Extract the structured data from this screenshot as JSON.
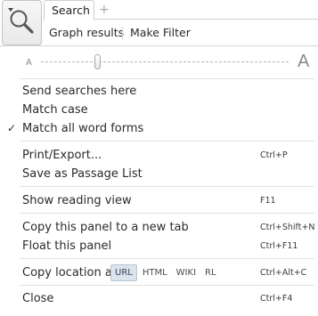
{
  "header": {
    "tabs": [
      {
        "label": "Search"
      }
    ],
    "add_tab_label": "+",
    "toolbar": {
      "graph_results": "Graph results",
      "make_filter": "Make Filter"
    }
  },
  "zoom": {
    "small_label": "A",
    "large_label": "A",
    "level": 0.23
  },
  "menu": {
    "send_searches_here": "Send searches here",
    "match_case": "Match case",
    "match_all_word_forms": {
      "label": "Match all word forms",
      "checked": true,
      "check_glyph": "✓"
    },
    "print_export": {
      "label": "Print/Export...",
      "shortcut": "Ctrl+P"
    },
    "save_passage_list": "Save as Passage List",
    "show_reading_view": {
      "label": "Show reading view",
      "shortcut": "F11"
    },
    "copy_panel_new_tab": {
      "label": "Copy this panel to a new tab",
      "shortcut": "Ctrl+Shift+N"
    },
    "float_panel": {
      "label": "Float this panel",
      "shortcut": "Ctrl+F11"
    },
    "copy_location": {
      "label": "Copy location as:",
      "options": [
        "URL",
        "HTML",
        "WIKI",
        "RL"
      ],
      "selected": "URL",
      "shortcut": "Ctrl+Alt+C"
    },
    "close": {
      "label": "Close",
      "shortcut": "Ctrl+F4"
    }
  },
  "colors": {
    "accent_selected_bg": "#dbe3ec",
    "text": "#2b2b2b",
    "separator": "#e2e2e2"
  }
}
